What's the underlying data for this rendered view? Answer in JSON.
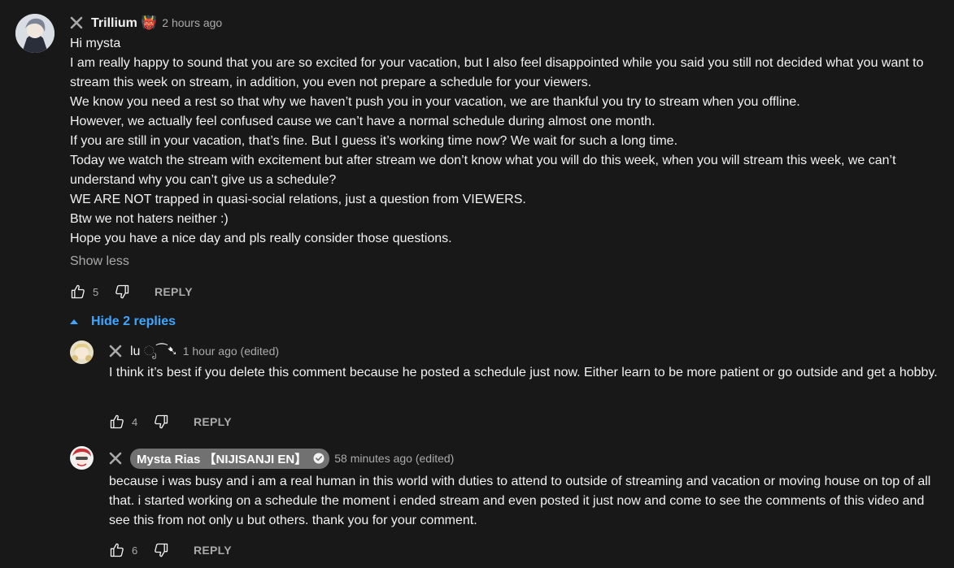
{
  "comment": {
    "author": "Trillium 👹",
    "time": "2 hours ago",
    "lines": [
      "Hi mysta",
      "I am really happy to sound that you are so excited for your vacation, but I also feel disappointed while you said you still not decided what you want to stream this week on stream, in addition, you even not prepare a schedule for your viewers.",
      "We know you need a rest so that why we haven’t push you in your vacation, we are thankful you try to stream when you offline.",
      "However, we actually feel confused cause we can’t have a normal schedule during almost one month.",
      "If you are still in your vacation, that’s fine. But I guess it’s working time now? We wait for such a long time.",
      "Today we watch the stream with excitement but after stream we don’t know what you will do this week, when you will stream this week, we can’t understand why you can’t give us a schedule?",
      "WE ARE NOT trapped in quasi-social relations, just a question from VIEWERS.",
      "Btw we not haters neither :)",
      "Hope you have a nice day and pls really consider those questions."
    ],
    "show_less": "Show less",
    "likes": "5",
    "reply_label": "REPLY"
  },
  "hide_replies": "Hide 2 replies",
  "replies": [
    {
      "author": "lu ೃ⁀➷",
      "time": "1 hour ago (edited)",
      "text": "I think it’s best if you delete this comment because he posted a schedule just now.  Either learn to be more patient or go outside and get a hobby.",
      "likes": "4",
      "reply_label": "REPLY"
    },
    {
      "author": "Mysta Rias 【NIJISANJI EN】",
      "time": "58 minutes ago (edited)",
      "text": "because i was busy and i am a real human in this world with duties to attend to outside of streaming and vacation or moving house on top of all that. i started working on a schedule the moment i ended stream and even posted it just now and come to see the comments of this video and see this from not only u but others. thank you for your comment.",
      "likes": "6",
      "reply_label": "REPLY"
    }
  ],
  "colors": {
    "background": "#181818",
    "text": "#f1f1f1",
    "muted": "#aaaaaa",
    "link": "#3ea6ff",
    "pill": "#717171"
  },
  "icons": [
    "close-icon",
    "thumb-up-icon",
    "thumb-down-icon",
    "caret-up-icon",
    "verified-check-icon"
  ]
}
